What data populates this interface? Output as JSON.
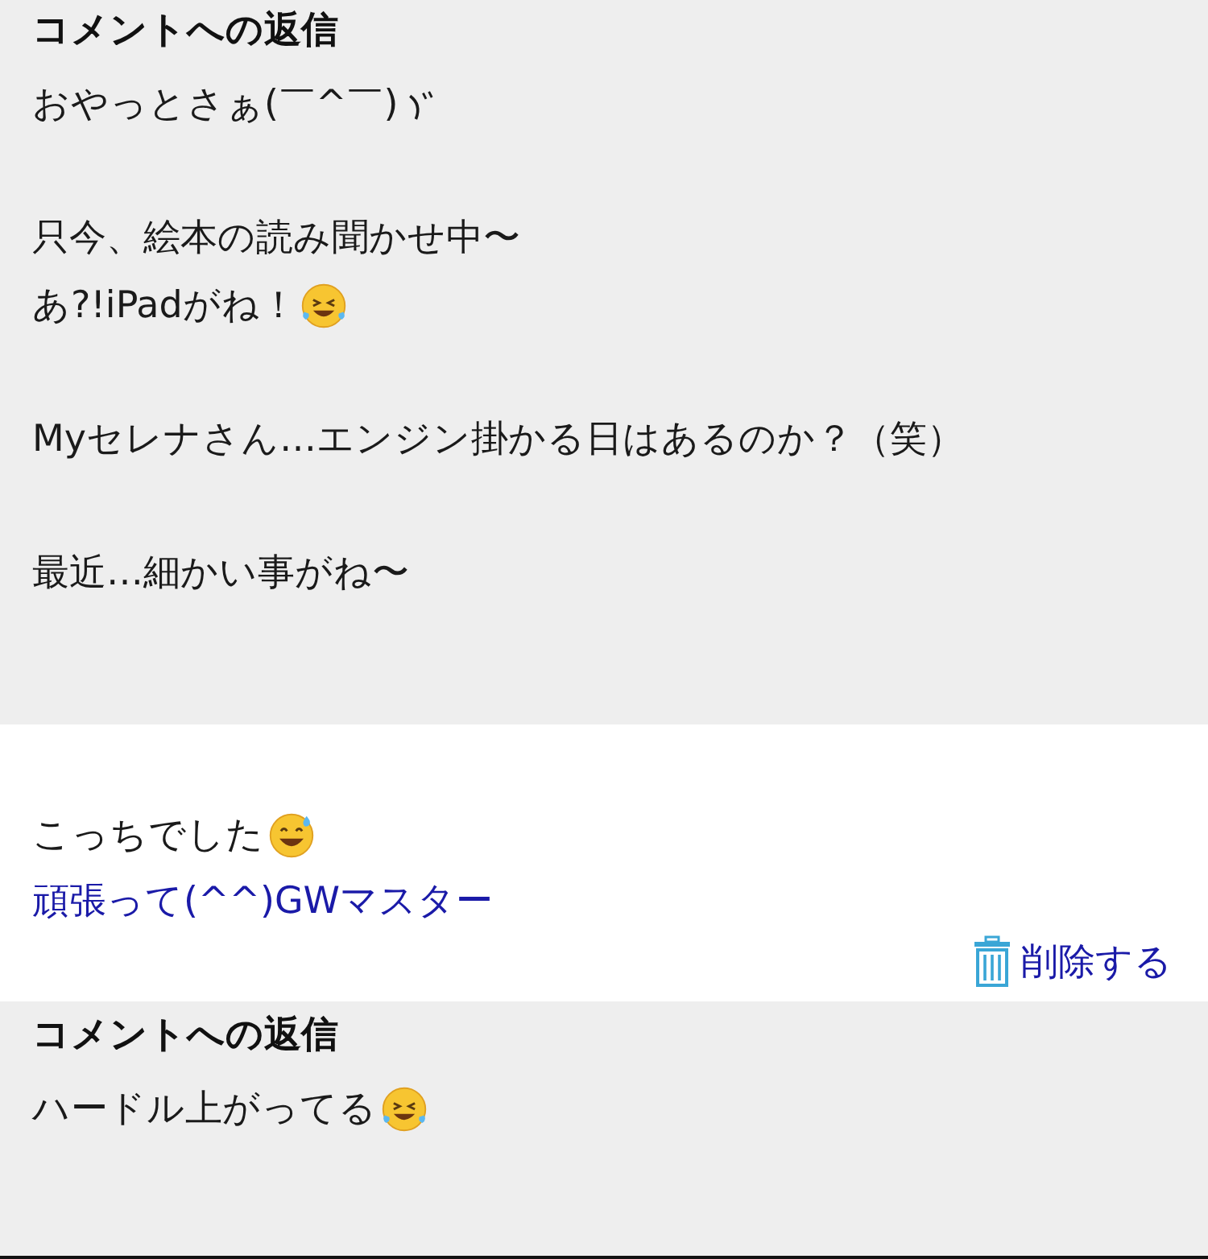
{
  "blocks": [
    {
      "kind": "reply",
      "heading": "コメントへの返信",
      "paragraphs": [
        [
          {
            "text": "おやっとさぁ(￣^￣)",
            "kind": "mark"
          }
        ],
        [
          {
            "text": "只今、絵本の読み聞かせ中〜"
          },
          {
            "text": "あ?!iPadがね！",
            "kind": "laugh"
          }
        ],
        [
          {
            "text": "Myセレナさん…エンジン掛かる日はあるのか？（笑）"
          }
        ],
        [
          {
            "text": "最近…細かい事がね〜"
          }
        ]
      ]
    },
    {
      "kind": "comment",
      "paragraphs": [
        [
          {
            "text": "こっちでした",
            "kind": "sweat"
          }
        ]
      ],
      "author": "頑張って(^^)GWマスター",
      "delete": "削除する"
    },
    {
      "kind": "reply",
      "heading": "コメントへの返信",
      "paragraphs": [
        [
          {
            "text": "ハードル上がってる",
            "kind": "laugh"
          }
        ]
      ]
    }
  ]
}
